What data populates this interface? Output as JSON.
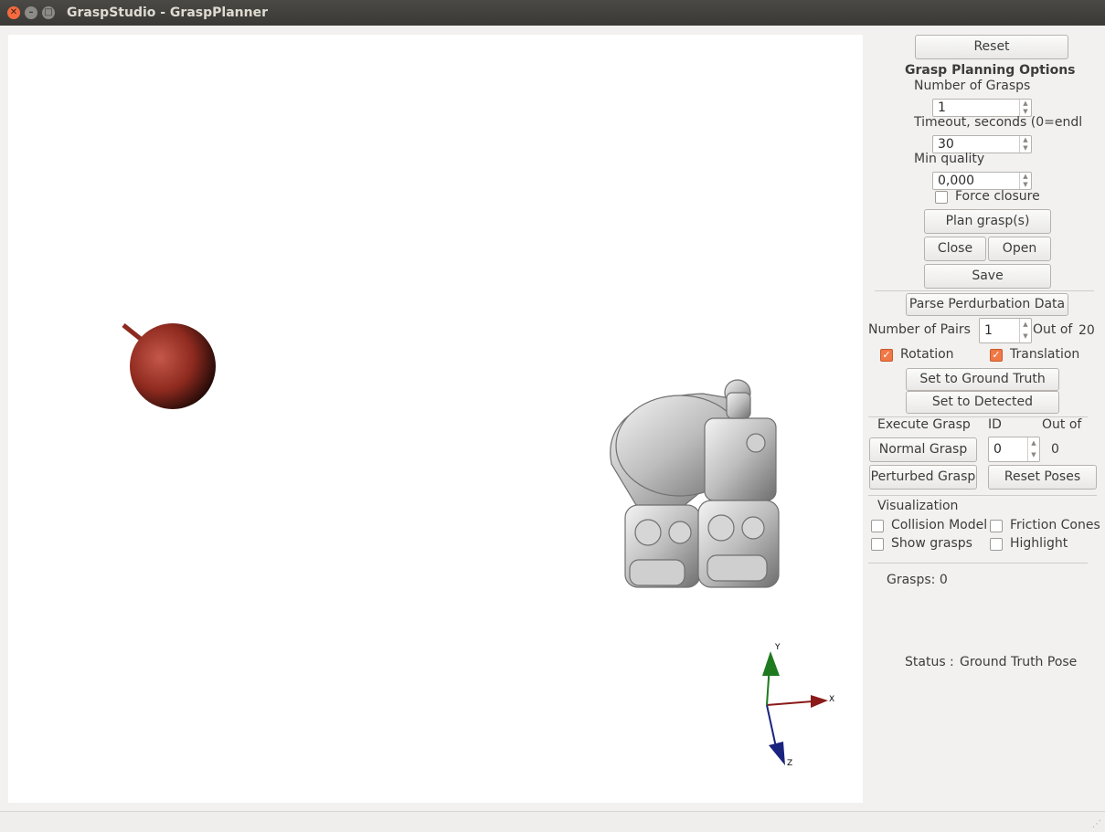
{
  "window": {
    "title": "GraspStudio - GraspPlanner"
  },
  "panel": {
    "reset_label": "Reset",
    "grasp_planning_title": "Grasp Planning Options",
    "num_grasps_label": "Number of Grasps",
    "num_grasps_value": "1",
    "timeout_label": "Timeout, seconds (0=endl",
    "timeout_value": "30",
    "min_quality_label": "Min quality",
    "min_quality_value": "0,000",
    "force_closure_label": "Force closure",
    "force_closure_checked": false,
    "plan_grasps_label": "Plan grasp(s)",
    "close_label": "Close",
    "open_label": "Open",
    "save_label": "Save",
    "parse_perturbation_label": "Parse Perdurbation Data",
    "num_pairs_label": "Number of Pairs",
    "num_pairs_value": "1",
    "out_of_label": "Out of",
    "out_of_value": "20",
    "rotation_label": "Rotation",
    "rotation_checked": true,
    "translation_label": "Translation",
    "translation_checked": true,
    "set_ground_truth_label": "Set to Ground Truth",
    "set_detected_label": "Set to Detected",
    "execute_grasp_label": "Execute Grasp",
    "id_label": "ID",
    "exec_out_of_label": "Out of",
    "id_value": "0",
    "exec_out_of_value": "0",
    "normal_grasp_label": "Normal Grasp",
    "perturbed_grasp_label": "Perturbed Grasp",
    "reset_poses_label": "Reset Poses",
    "visualization_title": "Visualization",
    "collision_model_label": "Collision Model",
    "friction_cones_label": "Friction Cones",
    "show_grasps_label": "Show grasps",
    "highlight_label": "Highlight",
    "grasps_count_text": "Grasps: 0",
    "status_label": "Status :",
    "status_value": "Ground Truth Pose"
  },
  "viewer": {
    "axis_x_label": "X",
    "axis_y_label": "Y",
    "axis_z_label": "Z",
    "axis_x_color": "#8b1a1a",
    "axis_y_color": "#1f7a1f",
    "axis_z_color": "#1a237e",
    "object_color": "#9c2b1e"
  }
}
